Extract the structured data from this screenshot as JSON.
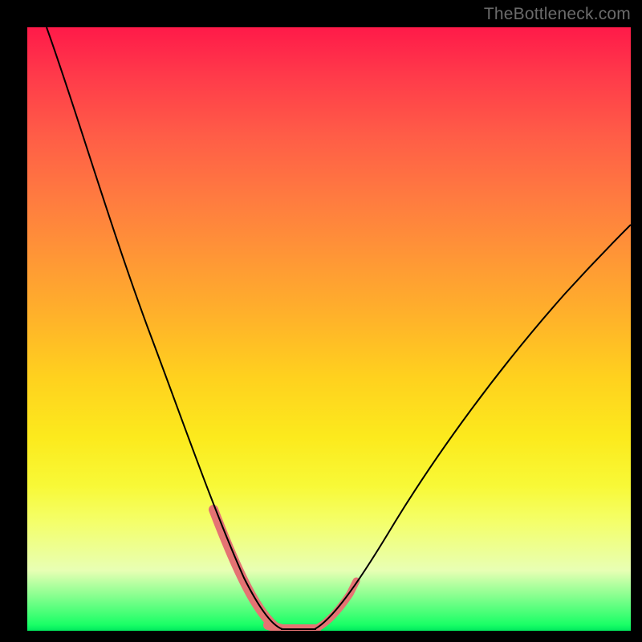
{
  "watermark": "TheBottleneck.com",
  "chart_data": {
    "type": "line",
    "title": "",
    "xlabel": "",
    "ylabel": "",
    "xlim": [
      0,
      100
    ],
    "ylim": [
      0,
      100
    ],
    "grid": false,
    "axes_visible": false,
    "background_gradient": {
      "direction": "vertical",
      "stops": [
        {
          "pos": 0.0,
          "color": "#ff1a49"
        },
        {
          "pos": 0.5,
          "color": "#ffb22a"
        },
        {
          "pos": 0.8,
          "color": "#f8f937"
        },
        {
          "pos": 0.99,
          "color": "#1aff66"
        }
      ]
    },
    "series": [
      {
        "name": "left-branch",
        "x": [
          3,
          8,
          14,
          20,
          26,
          31,
          35,
          38,
          40,
          42
        ],
        "y": [
          100,
          86,
          68,
          50,
          34,
          20,
          10,
          4,
          1,
          0
        ],
        "stroke": "#000000"
      },
      {
        "name": "valley",
        "x": [
          42,
          45,
          48
        ],
        "y": [
          0,
          0,
          0
        ],
        "stroke": "#000000"
      },
      {
        "name": "right-branch",
        "x": [
          48,
          52,
          58,
          66,
          76,
          88,
          100
        ],
        "y": [
          0,
          5,
          15,
          28,
          42,
          55,
          67
        ],
        "stroke": "#000000"
      }
    ],
    "highlight_segments": [
      {
        "name": "left-pink",
        "x": [
          31,
          35,
          38,
          40,
          42
        ],
        "y": [
          20,
          10,
          4,
          1,
          0
        ],
        "stroke": "#e57373",
        "width": 12
      },
      {
        "name": "bottom-pink",
        "x": [
          40,
          42,
          45,
          48
        ],
        "y": [
          1,
          0,
          0,
          0
        ],
        "stroke": "#e57373",
        "width": 12
      },
      {
        "name": "right-pink",
        "x": [
          48,
          50,
          52,
          54
        ],
        "y": [
          0,
          3,
          6,
          10
        ],
        "stroke": "#e57373",
        "width": 9
      }
    ]
  }
}
